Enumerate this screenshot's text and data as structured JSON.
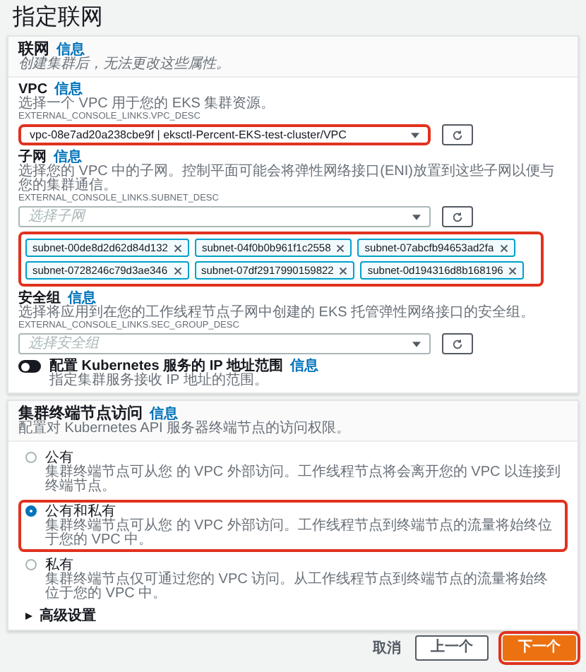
{
  "page_title": "指定联网",
  "networking": {
    "title": "联网",
    "info": "信息",
    "description": "创建集群后，无法更改这些属性。",
    "vpc": {
      "label": "VPC",
      "info": "信息",
      "description": "选择一个 VPC 用于您的 EKS 集群资源。",
      "hint": "EXTERNAL_CONSOLE_LINKS.VPC_DESC",
      "value": "vpc-08e7ad20a238cbe9f | eksctl-Percent-EKS-test-cluster/VPC",
      "highlighted": true
    },
    "subnets": {
      "label": "子网",
      "info": "信息",
      "description": "选择您的 VPC 中的子网。控制平面可能会将弹性网络接口(ENI)放置到这些子网以便与您的集群通信。",
      "hint": "EXTERNAL_CONSOLE_LINKS.SUBNET_DESC",
      "placeholder": "选择子网",
      "highlighted": true,
      "tokens": [
        "subnet-00de8d2d62d84d132",
        "subnet-04f0b0b961f1c2558",
        "subnet-07abcfb94653ad2fa",
        "subnet-0728246c79d3ae346",
        "subnet-07df2917990159822",
        "subnet-0d194316d8b168196"
      ]
    },
    "security_groups": {
      "label": "安全组",
      "info": "信息",
      "description": "选择将应用到在您的工作线程节点子网中创建的 EKS 托管弹性网络接口的安全组。",
      "hint": "EXTERNAL_CONSOLE_LINKS.SEC_GROUP_DESC",
      "placeholder": "选择安全组"
    },
    "service_ip_range": {
      "label": "配置 Kubernetes 服务的 IP 地址范围",
      "info": "信息",
      "description": "指定集群服务接收 IP 地址的范围。",
      "on": false
    }
  },
  "endpoint_access": {
    "title": "集群终端节点访问",
    "info": "信息",
    "description": "配置对 Kubernetes API 服务器终端节点的访问权限。",
    "options": [
      {
        "label": "公有",
        "description": "集群终端节点可从您 的 VPC 外部访问。工作线程节点将会离开您的 VPC 以连接到终端节点。",
        "selected": false,
        "highlighted": false
      },
      {
        "label": "公有和私有",
        "description": "集群终端节点可从您 的 VPC 外部访问。工作线程节点到终端节点的流量将始终位于您的 VPC 中。",
        "selected": true,
        "highlighted": true
      },
      {
        "label": "私有",
        "description": "集群终端节点仅可通过您的 VPC 访问。从工作线程节点到终端节点的流量将始终位于您的 VPC 中。",
        "selected": false,
        "highlighted": false
      }
    ],
    "advanced": {
      "label": "高级设置",
      "expanded": false
    }
  },
  "footer": {
    "cancel": "取消",
    "previous": "上一个",
    "next": "下一个",
    "next_highlighted": true
  }
}
